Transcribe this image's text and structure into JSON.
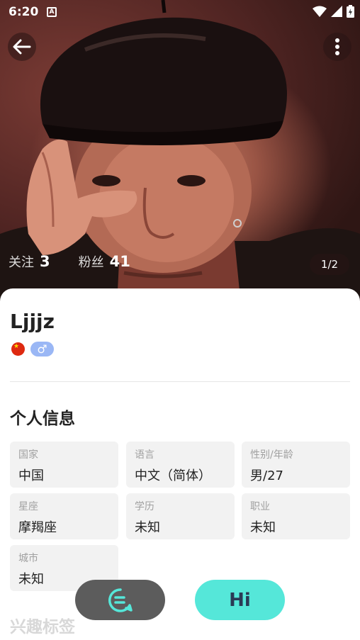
{
  "status_bar": {
    "time": "6:20",
    "notification_letter": "A",
    "icons": [
      "wifi-icon",
      "signal-icon",
      "battery-charging-icon"
    ]
  },
  "header": {
    "back_icon": "arrow-left-icon",
    "more_icon": "more-vertical-icon"
  },
  "stats": {
    "following_label": "关注",
    "following_count": "3",
    "followers_label": "粉丝",
    "followers_count": "41"
  },
  "photo": {
    "page_indicator": "1/2"
  },
  "profile": {
    "username": "Ljjjz",
    "country_flag": "china-flag-icon",
    "gender_symbol": "♂"
  },
  "personal_info": {
    "title": "个人信息",
    "fields": [
      {
        "label": "国家",
        "value": "中国"
      },
      {
        "label": "语言",
        "value": "中文（简体）"
      },
      {
        "label": "性别/年龄",
        "value": "男/27"
      },
      {
        "label": "星座",
        "value": "摩羯座"
      },
      {
        "label": "学历",
        "value": "未知"
      },
      {
        "label": "职业",
        "value": "未知"
      },
      {
        "label": "城市",
        "value": "未知"
      }
    ]
  },
  "interests": {
    "title": "兴趣标签"
  },
  "actions": {
    "chat_icon": "chat-bubble-icon",
    "hi_label": "Hi"
  },
  "colors": {
    "accent": "#55e7d9",
    "chat_button": "#5c5c5c",
    "gender_badge": "#9ab7f5"
  }
}
